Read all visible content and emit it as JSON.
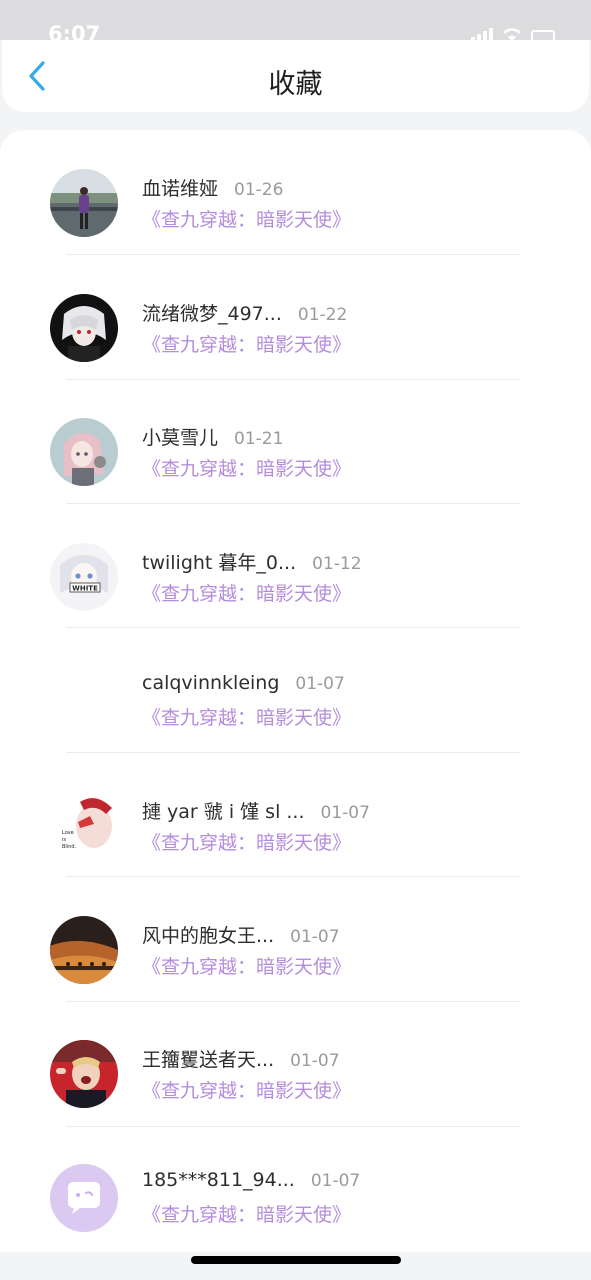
{
  "status_bar": {
    "time": "6:07"
  },
  "nav": {
    "title": "收藏",
    "back_icon": "chevron-left-icon"
  },
  "colors": {
    "accent": "#39a9e8",
    "book_title": "#b48cdc",
    "name": "#2e2e2e",
    "date": "#9a9a9a"
  },
  "items": [
    {
      "name": "血诺维娅",
      "date": "01-26",
      "book": "《查九穿越：暗影天使》",
      "avatar": "photo-person-outdoors"
    },
    {
      "name": "流绪微梦_497...",
      "date": "01-22",
      "book": "《查九穿越：暗影天使》",
      "avatar": "anime-dark-hair"
    },
    {
      "name": "小莫雪儿",
      "date": "01-21",
      "book": "《查九穿越：暗影天使》",
      "avatar": "anime-pink-hair"
    },
    {
      "name": "twilight 暮年_0...",
      "date": "01-12",
      "book": "《查九穿越：暗影天使》",
      "avatar": "anime-white-hair"
    },
    {
      "name": "calqvinnkleing",
      "date": "01-07",
      "book": "《查九穿越：暗影天使》",
      "avatar": "none"
    },
    {
      "name": "摙 yar 虢 i 馑 sl ...",
      "date": "01-07",
      "book": "《查九穿越：暗影天使》",
      "avatar": "stylized-portrait"
    },
    {
      "name": "风中的胞女王...",
      "date": "01-07",
      "book": "《查九穿越：暗影天使》",
      "avatar": "desert-camels"
    },
    {
      "name": "王籒矍送者天...",
      "date": "01-07",
      "book": "《查九穿越：暗影天使》",
      "avatar": "child-photo"
    },
    {
      "name": "185***811_94...",
      "date": "01-07",
      "book": "《查九穿越：暗影天使》",
      "avatar": "default-chat-bubble"
    }
  ]
}
